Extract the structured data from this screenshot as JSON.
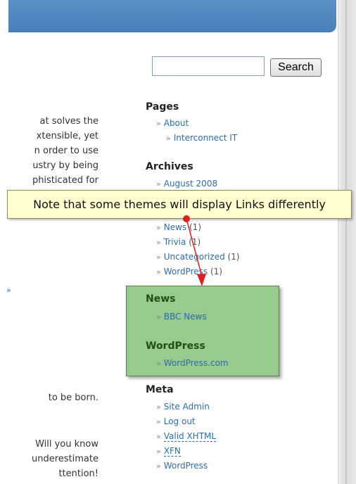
{
  "search": {
    "button_label": "Search",
    "value": ""
  },
  "left_text": {
    "block1": [
      "at solves the",
      "xtensible, yet",
      "n order to use",
      "ustry by being",
      "phisticated for"
    ],
    "line_born": "to be born.",
    "block2": [
      "Will you know",
      "underestimate",
      "ttention!"
    ],
    "chevron": "»"
  },
  "sidebar": {
    "pages": {
      "heading": "Pages",
      "items": [
        "About",
        "Interconnect IT"
      ]
    },
    "archives": {
      "heading": "Archives",
      "items": [
        "August 2008"
      ]
    },
    "categories": [
      {
        "label": "News",
        "count": "(1)"
      },
      {
        "label": "Trivia",
        "count": "(1)"
      },
      {
        "label": "Uncategorized",
        "count": "(1)"
      },
      {
        "label": "WordPress",
        "count": "(1)"
      }
    ],
    "links_box": {
      "news_heading": "News",
      "news_link": "BBC News",
      "wp_heading": "WordPress",
      "wp_link": "WordPress.com"
    },
    "meta": {
      "heading": "Meta",
      "items": [
        "Site Admin",
        "Log out",
        "Valid XHTML",
        "XFN",
        "WordPress"
      ]
    }
  },
  "tooltip": {
    "text": "Note that some themes will display Links differently"
  },
  "colors": {
    "tooltip_bg": "#ffffd0",
    "box_bg": "#98c98d",
    "arrow": "#e02020",
    "link": "#2a6cb0"
  }
}
